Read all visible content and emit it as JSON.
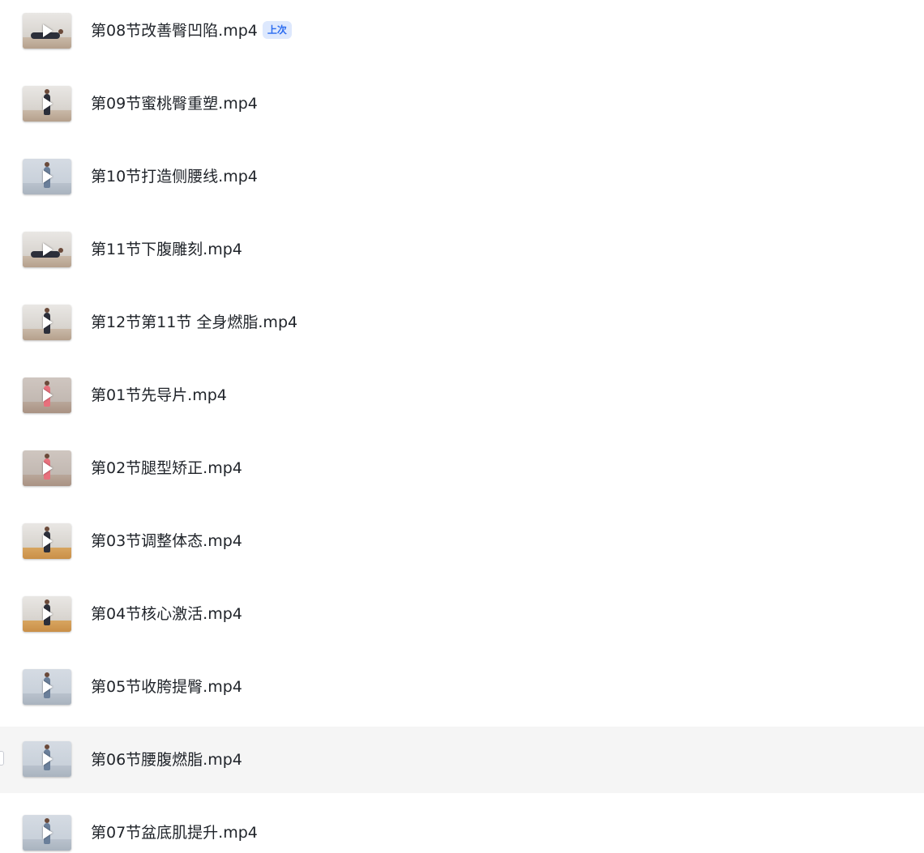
{
  "files": [
    {
      "name": "第08节改善臀凹陷.mp4",
      "badge": "上次"
    },
    {
      "name": "第09节蜜桃臀重塑.mp4"
    },
    {
      "name": "第10节打造侧腰线.mp4"
    },
    {
      "name": "第11节下腹雕刻.mp4"
    },
    {
      "name": "第12节第11节 全身燃脂.mp4"
    },
    {
      "name": "第01节先导片.mp4"
    },
    {
      "name": "第02节腿型矫正.mp4"
    },
    {
      "name": "第03节调整体态.mp4"
    },
    {
      "name": "第04节核心激活.mp4"
    },
    {
      "name": "第05节收胯提臀.mp4"
    },
    {
      "name": "第06节腰腹燃脂.mp4"
    },
    {
      "name": "第07节盆底肌提升.mp4"
    }
  ],
  "icons": {
    "thumbnail_overlay": "play-icon",
    "row_select": "checkbox"
  },
  "colors": {
    "badge_text": "#2b6cf0",
    "badge_bg": "#dde8fd",
    "hover_bg": "#f5f5f5",
    "text": "#1f2329"
  }
}
